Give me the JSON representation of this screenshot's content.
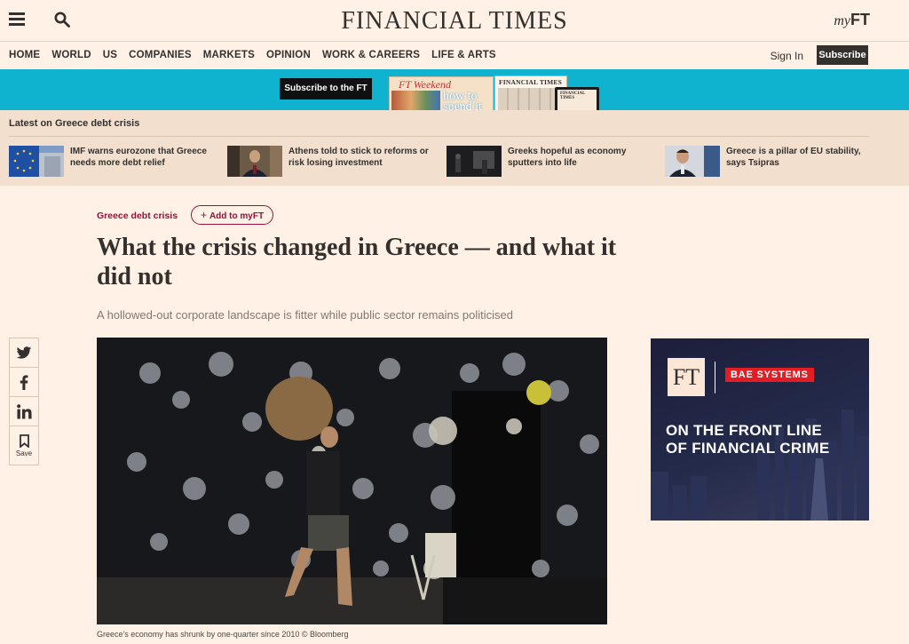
{
  "header": {
    "logo": "FINANCIAL TIMES",
    "myft_prefix": "my",
    "myft_suffix": "FT"
  },
  "nav": {
    "items": [
      "HOME",
      "WORLD",
      "US",
      "COMPANIES",
      "MARKETS",
      "OPINION",
      "WORK & CAREERS",
      "LIFE & ARTS"
    ],
    "sign_in": "Sign In",
    "subscribe": "Subscribe"
  },
  "banner": {
    "button": "Subscribe to the FT",
    "weekend_title": "FT Weekend",
    "weekend_text": "how to spend it",
    "paper_title": "FINANCIAL TIMES",
    "tablet_title": "FINANCIAL TIMES"
  },
  "latest": {
    "heading": "Latest on Greece debt crisis",
    "items": [
      {
        "title": "IMF warns eurozone that Greece needs more debt relief"
      },
      {
        "title": "Athens told to stick to reforms or risk losing investment"
      },
      {
        "title": "Greeks hopeful as economy sputters into life"
      },
      {
        "title": "Greece is a pillar of EU stability, says Tsipras"
      }
    ]
  },
  "article": {
    "topic": "Greece debt crisis",
    "add_myft": "Add to myFT",
    "headline": "What the crisis changed in Greece — and what it did not",
    "standfirst": "A hollowed-out corporate landscape is fitter while public sector remains politicised",
    "caption": "Greece's economy has shrunk by one-quarter since 2010 © Bloomberg"
  },
  "share": {
    "save_label": "Save"
  },
  "ad": {
    "ft_logo": "FT",
    "brand": "BAE SYSTEMS",
    "line1": "ON THE FRONT LINE",
    "line2": "OF FINANCIAL CRIME"
  },
  "colors": {
    "page_bg": "#fff1e5",
    "claret": "#990f3d",
    "banner_teal": "#0fb3cf",
    "bae_red": "#e41c23",
    "latest_bg": "#f2dfce"
  }
}
